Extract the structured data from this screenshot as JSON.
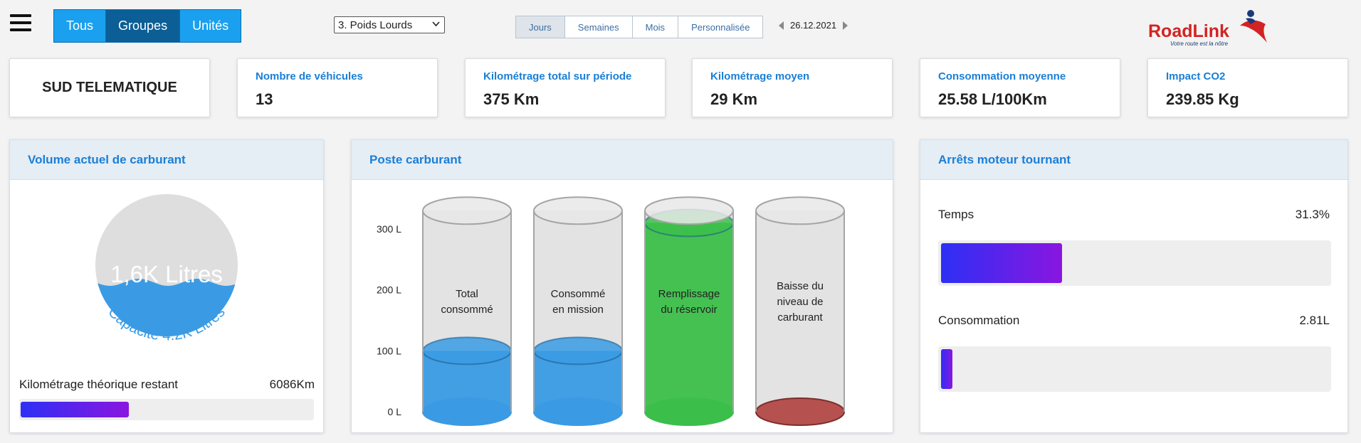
{
  "toolbar": {
    "segments": [
      "Tous",
      "Groupes",
      "Unités"
    ],
    "active_segment": "Groupes",
    "vehicle_select": "3. Poids Lourds",
    "periods": [
      "Jours",
      "Semaines",
      "Mois",
      "Personnalisée"
    ],
    "active_period": "Jours",
    "date": "26.12.2021"
  },
  "logo": {
    "brand": "RoadLink",
    "tagline": "Votre route est la nôtre",
    "colors": {
      "red": "#d32323",
      "navy": "#1b3a7a"
    }
  },
  "kpis": {
    "company": "SUD TELEMATIQUE",
    "vehicles": {
      "label": "Nombre de véhicules",
      "value": "13"
    },
    "total_km": {
      "label": "Kilométrage total sur période",
      "value": "375 Km"
    },
    "avg_km": {
      "label": "Kilométrage moyen",
      "value": "29 Km"
    },
    "avg_consumption": {
      "label": "Consommation moyenne",
      "value": "25.58 L/100Km"
    },
    "co2": {
      "label": "Impact CO2",
      "value": "239.85 Kg"
    }
  },
  "fuel_volume": {
    "title": "Volume actuel de carburant",
    "level_text": "1,6K Litres",
    "capacity_text": "Capacité 4.2K Litres",
    "fill_fraction": 0.38,
    "range_label": "Kilométrage théorique restant",
    "range_value": "6086Km",
    "range_fraction": 0.37
  },
  "fuel_post": {
    "title": "Poste carburant",
    "y_ticks": [
      "300 L",
      "200 L",
      "100 L",
      "0 L"
    ],
    "ymax": 330,
    "cylinders": [
      {
        "lines": [
          "Total",
          "consommé"
        ],
        "value": 100,
        "color": "#3a9be4"
      },
      {
        "lines": [
          "Consommé",
          "en mission"
        ],
        "value": 100,
        "color": "#3a9be4"
      },
      {
        "lines": [
          "Remplissage",
          "du réservoir"
        ],
        "value": 310,
        "color": "#3cbf4a"
      },
      {
        "lines": [
          "Baisse du",
          "niveau de",
          "carburant"
        ],
        "value": 0,
        "color": "#b5524f"
      }
    ]
  },
  "idling": {
    "title": "Arrêts moteur tournant",
    "items": [
      {
        "label": "Temps",
        "value": "31.3%",
        "fraction": 0.313
      },
      {
        "label": "Consommation",
        "value": "2.81L",
        "fraction": 0.03
      }
    ]
  }
}
